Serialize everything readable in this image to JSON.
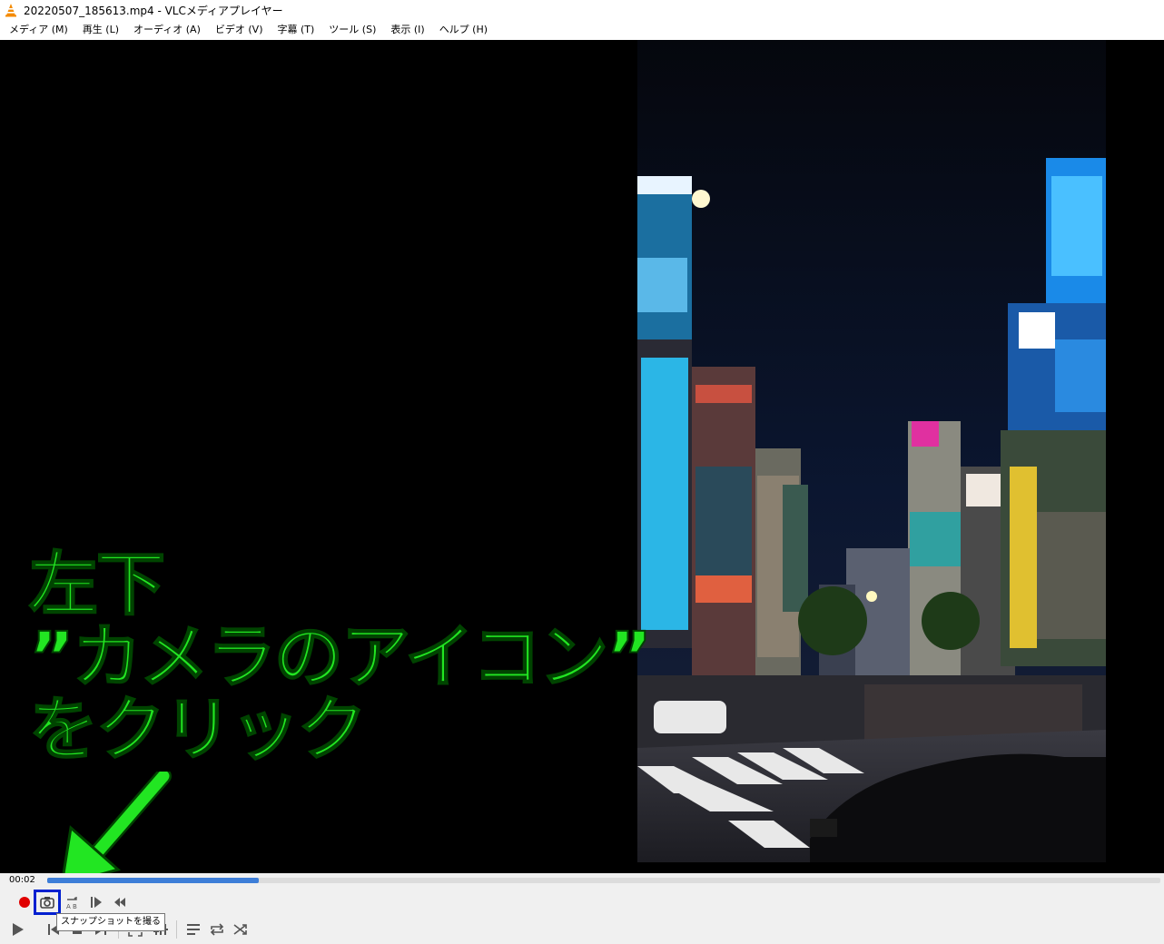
{
  "window": {
    "title": "20220507_185613.mp4 - VLCメディアプレイヤー",
    "icon": "vlc-cone-icon"
  },
  "menu": [
    {
      "label": "メディア (M)"
    },
    {
      "label": "再生 (L)"
    },
    {
      "label": "オーディオ (A)"
    },
    {
      "label": "ビデオ (V)"
    },
    {
      "label": "字幕 (T)"
    },
    {
      "label": "ツール (S)"
    },
    {
      "label": "表示 (I)"
    },
    {
      "label": "ヘルプ (H)"
    }
  ],
  "video": {
    "scene": "night-street-crossing"
  },
  "annotation": {
    "line1": "左下",
    "line2": "”カメラのアイコン”",
    "line3": "をクリック",
    "color": "#22e622"
  },
  "seek": {
    "elapsed": "00:02",
    "progress_fraction": 0.19
  },
  "controls": {
    "top_row": [
      "record-icon",
      "snapshot-icon",
      "loop-ab-icon",
      "frame-step-icon",
      "slower-icon"
    ],
    "bottom_row": [
      "play-icon",
      "previous-icon",
      "stop-icon",
      "next-icon",
      "fullscreen-icon",
      "extended-settings-icon",
      "playlist-icon",
      "loop-icon",
      "shuffle-icon"
    ],
    "tooltip": "スナップショットを撮る",
    "highlight_color": "#0020d0"
  }
}
